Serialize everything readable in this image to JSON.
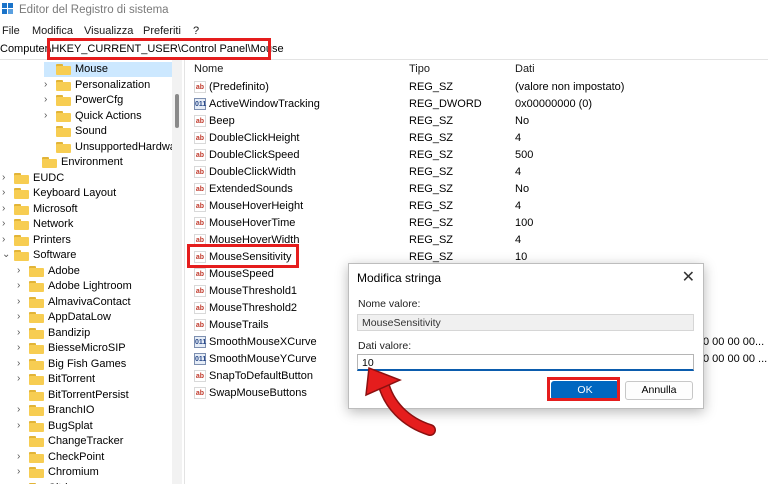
{
  "window": {
    "title": "Editor del Registro di sistema"
  },
  "menu": [
    "File",
    "Modifica",
    "Visualizza",
    "Preferiti",
    "?"
  ],
  "address": {
    "path": "Computer\\HKEY_CURRENT_USER\\Control Panel\\Mouse"
  },
  "tree": [
    {
      "label": "Mouse",
      "chevron": "",
      "selected": true
    },
    {
      "label": "Personalization",
      "chevron": "›"
    },
    {
      "label": "PowerCfg",
      "chevron": "›"
    },
    {
      "label": "Quick Actions",
      "chevron": "›"
    },
    {
      "label": "Sound",
      "chevron": ""
    },
    {
      "label": "UnsupportedHardwa",
      "chevron": ""
    },
    {
      "label": "Environment",
      "chevron": ""
    },
    {
      "label": "EUDC",
      "chevron": "›"
    },
    {
      "label": "Keyboard Layout",
      "chevron": "›"
    },
    {
      "label": "Microsoft",
      "chevron": "›"
    },
    {
      "label": "Network",
      "chevron": "›"
    },
    {
      "label": "Printers",
      "chevron": "›"
    },
    {
      "label": "Software",
      "chevron": "⌄"
    },
    {
      "label": "Adobe",
      "chevron": "›"
    },
    {
      "label": "Adobe Lightroom",
      "chevron": "›"
    },
    {
      "label": "AlmavivaContact",
      "chevron": "›"
    },
    {
      "label": "AppDataLow",
      "chevron": "›"
    },
    {
      "label": "Bandizip",
      "chevron": "›"
    },
    {
      "label": "BiesseMicroSIP",
      "chevron": "›"
    },
    {
      "label": "Big Fish Games",
      "chevron": "›"
    },
    {
      "label": "BitTorrent",
      "chevron": "›"
    },
    {
      "label": "BitTorrentPersist",
      "chevron": ""
    },
    {
      "label": "BranchIO",
      "chevron": "›"
    },
    {
      "label": "BugSplat",
      "chevron": "›"
    },
    {
      "label": "ChangeTracker",
      "chevron": ""
    },
    {
      "label": "CheckPoint",
      "chevron": "›"
    },
    {
      "label": "Chromium",
      "chevron": "›"
    },
    {
      "label": "Citrix",
      "chevron": "›"
    }
  ],
  "columns": {
    "name": "Nome",
    "type": "Tipo",
    "data": "Dati"
  },
  "values": [
    {
      "icon": "ab",
      "name": "(Predefinito)",
      "type": "REG_SZ",
      "data": "(valore non impostato)"
    },
    {
      "icon": "dw",
      "name": "ActiveWindowTracking",
      "type": "REG_DWORD",
      "data": "0x00000000 (0)"
    },
    {
      "icon": "ab",
      "name": "Beep",
      "type": "REG_SZ",
      "data": "No"
    },
    {
      "icon": "ab",
      "name": "DoubleClickHeight",
      "type": "REG_SZ",
      "data": "4"
    },
    {
      "icon": "ab",
      "name": "DoubleClickSpeed",
      "type": "REG_SZ",
      "data": "500"
    },
    {
      "icon": "ab",
      "name": "DoubleClickWidth",
      "type": "REG_SZ",
      "data": "4"
    },
    {
      "icon": "ab",
      "name": "ExtendedSounds",
      "type": "REG_SZ",
      "data": "No"
    },
    {
      "icon": "ab",
      "name": "MouseHoverHeight",
      "type": "REG_SZ",
      "data": "4"
    },
    {
      "icon": "ab",
      "name": "MouseHoverTime",
      "type": "REG_SZ",
      "data": "100"
    },
    {
      "icon": "ab",
      "name": "MouseHoverWidth",
      "type": "REG_SZ",
      "data": "4"
    },
    {
      "icon": "ab",
      "name": "MouseSensitivity",
      "type": "REG_SZ",
      "data": "10"
    },
    {
      "icon": "ab",
      "name": "MouseSpeed",
      "type": "",
      "data": ""
    },
    {
      "icon": "ab",
      "name": "MouseThreshold1",
      "type": "",
      "data": ""
    },
    {
      "icon": "ab",
      "name": "MouseThreshold2",
      "type": "",
      "data": ""
    },
    {
      "icon": "ab",
      "name": "MouseTrails",
      "type": "",
      "data": ""
    },
    {
      "icon": "dw",
      "name": "SmoothMouseXCurve",
      "type": "",
      "data": "0 00 00 00..."
    },
    {
      "icon": "dw",
      "name": "SmoothMouseYCurve",
      "type": "",
      "data": "0 00 00 00 ..."
    },
    {
      "icon": "ab",
      "name": "SnapToDefaultButton",
      "type": "",
      "data": ""
    },
    {
      "icon": "ab",
      "name": "SwapMouseButtons",
      "type": "",
      "data": ""
    }
  ],
  "dialog": {
    "title": "Modifica stringa",
    "close_glyph": "✕",
    "name_label": "Nome valore:",
    "name_value": "MouseSensitivity",
    "data_label": "Dati valore:",
    "data_value": "10",
    "ok_label": "OK",
    "cancel_label": "Annulla"
  },
  "colors": {
    "highlight": "#e51d1d",
    "selection": "#cce8ff",
    "accent": "#0067c0",
    "folder": "#f7cd52"
  }
}
